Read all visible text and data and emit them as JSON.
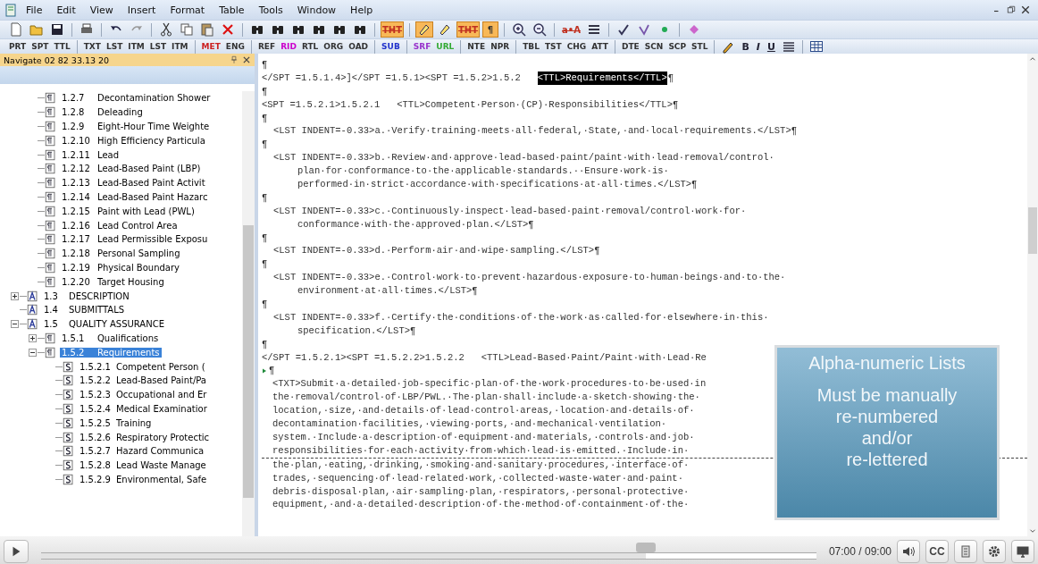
{
  "menu": [
    "File",
    "Edit",
    "View",
    "Insert",
    "Format",
    "Table",
    "Tools",
    "Window",
    "Help"
  ],
  "toolbar": [
    {
      "kind": "new",
      "on": false
    },
    {
      "kind": "open",
      "on": false
    },
    {
      "kind": "save",
      "on": false
    },
    {
      "kind": "sep"
    },
    {
      "kind": "print",
      "on": false
    },
    {
      "kind": "sep"
    },
    {
      "kind": "undo",
      "on": false
    },
    {
      "kind": "redo",
      "on": false
    },
    {
      "kind": "sep"
    },
    {
      "kind": "cut",
      "on": false
    },
    {
      "kind": "copy",
      "on": false
    },
    {
      "kind": "paste",
      "on": false
    },
    {
      "kind": "delete",
      "on": false
    },
    {
      "kind": "sep"
    },
    {
      "kind": "find",
      "on": false
    },
    {
      "kind": "find",
      "on": false
    },
    {
      "kind": "find",
      "on": false
    },
    {
      "kind": "find",
      "on": false
    },
    {
      "kind": "find",
      "on": false
    },
    {
      "kind": "find",
      "on": false
    },
    {
      "kind": "sep"
    },
    {
      "kind": "text",
      "label": "THT",
      "on": true
    },
    {
      "kind": "sep"
    },
    {
      "kind": "marker",
      "on": true
    },
    {
      "kind": "marker",
      "on": false
    },
    {
      "kind": "text",
      "label": "THT",
      "on": true
    },
    {
      "kind": "text",
      "label": "¶",
      "on": true
    },
    {
      "kind": "sep"
    },
    {
      "kind": "zoom-in",
      "on": false
    },
    {
      "kind": "zoom-out",
      "on": false
    },
    {
      "kind": "sep"
    },
    {
      "kind": "text",
      "label": "a•A",
      "on": false
    },
    {
      "kind": "list",
      "on": false
    },
    {
      "kind": "sep"
    },
    {
      "kind": "spell",
      "on": false
    },
    {
      "kind": "check",
      "on": false
    },
    {
      "kind": "dot",
      "on": false
    },
    {
      "kind": "sep"
    },
    {
      "kind": "diamond",
      "on": false
    }
  ],
  "tag_toolbar": [
    {
      "kind": "tag",
      "label": "PRT",
      "color": "#333333"
    },
    {
      "kind": "tag",
      "label": "SPT",
      "color": "#333333"
    },
    {
      "kind": "tag",
      "label": "TTL",
      "color": "#333333"
    },
    {
      "kind": "sep"
    },
    {
      "kind": "tag",
      "label": "TXT",
      "color": "#333333"
    },
    {
      "kind": "tag",
      "label": "LST",
      "color": "#333333"
    },
    {
      "kind": "tag",
      "label": "ITM",
      "color": "#333333"
    },
    {
      "kind": "tag",
      "label": "LST",
      "color": "#333333"
    },
    {
      "kind": "tag",
      "label": "ITM",
      "color": "#333333"
    },
    {
      "kind": "sep"
    },
    {
      "kind": "tag",
      "label": "MET",
      "color": "#cc2222"
    },
    {
      "kind": "tag",
      "label": "ENG",
      "color": "#333333"
    },
    {
      "kind": "sep"
    },
    {
      "kind": "tag",
      "label": "REF",
      "color": "#333333"
    },
    {
      "kind": "tag",
      "label": "RID",
      "color": "#cc00cc"
    },
    {
      "kind": "tag",
      "label": "RTL",
      "color": "#333333"
    },
    {
      "kind": "tag",
      "label": "ORG",
      "color": "#333333"
    },
    {
      "kind": "tag",
      "label": "OAD",
      "color": "#333333"
    },
    {
      "kind": "sep"
    },
    {
      "kind": "tag",
      "label": "SUB",
      "color": "#2233cc"
    },
    {
      "kind": "sep"
    },
    {
      "kind": "tag",
      "label": "SRF",
      "color": "#9933cc"
    },
    {
      "kind": "tag",
      "label": "URL",
      "color": "#33aa33"
    },
    {
      "kind": "sep"
    },
    {
      "kind": "tag",
      "label": "NTE",
      "color": "#333333"
    },
    {
      "kind": "tag",
      "label": "NPR",
      "color": "#333333"
    },
    {
      "kind": "sep"
    },
    {
      "kind": "tag",
      "label": "TBL",
      "color": "#333333"
    },
    {
      "kind": "tag",
      "label": "TST",
      "color": "#333333"
    },
    {
      "kind": "tag",
      "label": "CHG",
      "color": "#333333"
    },
    {
      "kind": "tag",
      "label": "ATT",
      "color": "#333333"
    },
    {
      "kind": "sep"
    },
    {
      "kind": "tag",
      "label": "DTE",
      "color": "#333333"
    },
    {
      "kind": "tag",
      "label": "SCN",
      "color": "#333333"
    },
    {
      "kind": "tag",
      "label": "SCP",
      "color": "#333333"
    },
    {
      "kind": "tag",
      "label": "STL",
      "color": "#333333"
    },
    {
      "kind": "sep"
    },
    {
      "kind": "pen"
    },
    {
      "kind": "bold",
      "label": "B"
    },
    {
      "kind": "italic",
      "label": "I"
    },
    {
      "kind": "underline",
      "label": "U"
    },
    {
      "kind": "align"
    },
    {
      "kind": "sep"
    },
    {
      "kind": "table"
    }
  ],
  "navigator": {
    "title": "Navigate 02 82 33.13 20",
    "tree": [
      {
        "kind": "group",
        "children": [
          {
            "kind": "para",
            "number": "1.2.7",
            "title": "Decontamination Shower",
            "selected": false
          },
          {
            "kind": "para",
            "number": "1.2.8",
            "title": "Deleading",
            "selected": false
          },
          {
            "kind": "para",
            "number": "1.2.9",
            "title": "Eight-Hour Time Weighte",
            "selected": false
          },
          {
            "kind": "para",
            "number": "1.2.10",
            "title": "High Efficiency Particula",
            "selected": false
          },
          {
            "kind": "para",
            "number": "1.2.11",
            "title": "Lead",
            "selected": false
          },
          {
            "kind": "para",
            "number": "1.2.12",
            "title": "Lead-Based Paint (LBP)",
            "selected": false
          },
          {
            "kind": "para",
            "number": "1.2.13",
            "title": "Lead-Based Paint Activit",
            "selected": false
          },
          {
            "kind": "para",
            "number": "1.2.14",
            "title": "Lead-Based Paint Hazarc",
            "selected": false
          },
          {
            "kind": "para",
            "number": "1.2.15",
            "title": "Paint with Lead (PWL)",
            "selected": false
          },
          {
            "kind": "para",
            "number": "1.2.16",
            "title": "Lead Control Area",
            "selected": false
          },
          {
            "kind": "para",
            "number": "1.2.17",
            "title": "Lead Permissible Exposu",
            "selected": false
          },
          {
            "kind": "para",
            "number": "1.2.18",
            "title": "Personal Sampling",
            "selected": false
          },
          {
            "kind": "para",
            "number": "1.2.19",
            "title": "Physical Boundary",
            "selected": false
          },
          {
            "kind": "para",
            "number": "1.2.20",
            "title": "Target Housing",
            "selected": false
          }
        ]
      },
      {
        "kind": "article",
        "number": "1.3",
        "title": "DESCRIPTION",
        "selected": false,
        "expanded": false
      },
      {
        "kind": "article",
        "number": "1.4",
        "title": "SUBMITTALS",
        "selected": false
      },
      {
        "kind": "article",
        "number": "1.5",
        "title": "QUALITY ASSURANCE",
        "selected": false,
        "expanded": true,
        "children": [
          {
            "kind": "para",
            "number": "1.5.1",
            "title": "Qualifications",
            "selected": false,
            "expanded": false
          },
          {
            "kind": "para",
            "number": "1.5.2",
            "title": "Requirements",
            "selected": true,
            "expanded": true,
            "children": [
              {
                "kind": "sub",
                "number": "1.5.2.1",
                "title": "Competent Person (",
                "selected": false
              },
              {
                "kind": "sub",
                "number": "1.5.2.2",
                "title": "Lead-Based Paint/Pa",
                "selected": false
              },
              {
                "kind": "sub",
                "number": "1.5.2.3",
                "title": "Occupational and Er",
                "selected": false
              },
              {
                "kind": "sub",
                "number": "1.5.2.4",
                "title": "Medical Examinatior",
                "selected": false
              },
              {
                "kind": "sub",
                "number": "1.5.2.5",
                "title": "Training",
                "selected": false
              },
              {
                "kind": "sub",
                "number": "1.5.2.6",
                "title": "Respiratory Protectic",
                "selected": false
              },
              {
                "kind": "sub",
                "number": "1.5.2.7",
                "title": "Hazard Communica",
                "selected": false
              },
              {
                "kind": "sub",
                "number": "1.5.2.8",
                "title": "Lead Waste Manage",
                "selected": false
              },
              {
                "kind": "sub",
                "number": "1.5.2.9",
                "title": "Environmental, Safe",
                "selected": false
              }
            ]
          }
        ]
      }
    ]
  },
  "document": {
    "lines": [
      {
        "kind": "mark",
        "text": "¶"
      },
      {
        "kind": "tag",
        "text": "</SPT =1.5.1.4>]</SPT =1.5.1><SPT =1.5.2>1.5.2   ",
        "selected_text": "<TTL>Requirements</TTL>",
        "end": "¶"
      },
      {
        "kind": "mark",
        "text": "¶"
      },
      {
        "kind": "tag",
        "text": "<SPT =1.5.2.1>1.5.2.1   <TTL>Competent·Person·(CP)·Responsibilities</TTL>¶"
      },
      {
        "kind": "mark",
        "text": "¶"
      },
      {
        "kind": "item",
        "text": "<LST INDENT=-0.33>a.·Verify·training·meets·all·federal,·State,·and·local·requirements.</LST>¶"
      },
      {
        "kind": "mark",
        "text": "¶"
      },
      {
        "kind": "item",
        "text": "<LST INDENT=-0.33>b.·Review·and·approve·lead-based·paint/paint·with·lead·removal/control·"
      },
      {
        "kind": "cont",
        "text": "plan·for·conformance·to·the·applicable·standards.··Ensure·work·is·"
      },
      {
        "kind": "cont",
        "text": "performed·in·strict·accordance·with·specifications·at·all·times.</LST>¶"
      },
      {
        "kind": "mark",
        "text": "¶"
      },
      {
        "kind": "item",
        "text": "<LST INDENT=-0.33>c.·Continuously·inspect·lead-based·paint·removal/control·work·for·"
      },
      {
        "kind": "cont",
        "text": "conformance·with·the·approved·plan.</LST>¶"
      },
      {
        "kind": "mark",
        "text": "¶"
      },
      {
        "kind": "item",
        "text": "<LST INDENT=-0.33>d.·Perform·air·and·wipe·sampling.</LST>¶"
      },
      {
        "kind": "mark",
        "text": "¶"
      },
      {
        "kind": "item",
        "text": "<LST INDENT=-0.33>e.·Control·work·to·prevent·hazardous·exposure·to·human·beings·and·to·the·"
      },
      {
        "kind": "cont",
        "text": "environment·at·all·times.</LST>¶"
      },
      {
        "kind": "mark",
        "text": "¶"
      },
      {
        "kind": "item",
        "text": "<LST INDENT=-0.33>f.·Certify·the·conditions·of·the·work·as·called·for·elsewhere·in·this·"
      },
      {
        "kind": "cont",
        "text": "specification.</LST>¶"
      },
      {
        "kind": "mark",
        "text": "¶"
      },
      {
        "kind": "tag",
        "text": "</SPT =1.5.2.1><SPT =1.5.2.2>1.5.2.2   <TTL>Lead-Based·Paint/Paint·with·Lead·Re"
      },
      {
        "kind": "cursor",
        "text": "¶"
      },
      {
        "kind": "body",
        "text": "<TXT>Submit·a·detailed·job-specific·plan·of·the·work·procedures·to·be·used·in"
      },
      {
        "kind": "body",
        "text": "the·removal/control·of·LBP/PWL.·The·plan·shall·include·a·sketch·showing·the·"
      },
      {
        "kind": "body",
        "text": "location,·size,·and·details·of·lead·control·areas,·location·and·details·of·"
      },
      {
        "kind": "body",
        "text": "decontamination·facilities,·viewing·ports,·and·mechanical·ventilation·"
      },
      {
        "kind": "body",
        "text": "system.·Include·a·description·of·equipment·and·materials,·controls·and·job·"
      },
      {
        "kind": "body",
        "text": "responsibilities·for·each·activity·from·which·lead·is·emitted.·Include·in·",
        "page_break": true
      },
      {
        "kind": "body",
        "text": "the·plan,·eating,·drinking,·smoking·and·sanitary·procedures,·interface·of·"
      },
      {
        "kind": "body",
        "text": "trades,·sequencing·of·lead·related·work,·collected·waste·water·and·paint·"
      },
      {
        "kind": "body",
        "text": "debris·disposal·plan,·air·sampling·plan,·respirators,·personal·protective·"
      },
      {
        "kind": "body",
        "text": "equipment,·and·a·detailed·description·of·the·method·of·containment·of·the·"
      }
    ]
  },
  "callout": {
    "title": "Alpha-numeric Lists",
    "body": "Must be manually\nre-numbered\nand/or\nre-lettered"
  },
  "player": {
    "level": 0.78,
    "time": "07:00 / 09:00",
    "cc": "CC"
  }
}
